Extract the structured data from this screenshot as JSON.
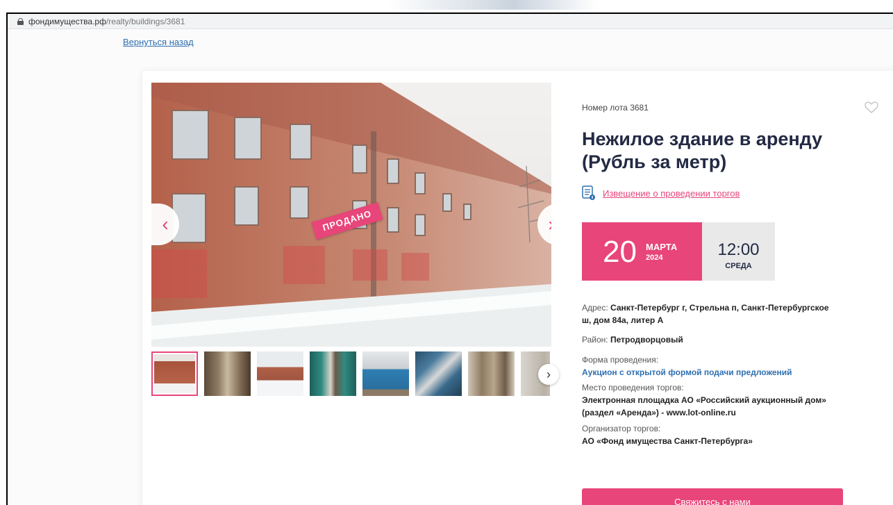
{
  "browser": {
    "url_domain": "фондимущества.рф",
    "url_path": "/realty/buildings/3681"
  },
  "page": {
    "back_link": "Вернуться назад"
  },
  "lot": {
    "number_label": "Номер лота 3681",
    "title": "Нежилое здание в аренду (Рубль за метр)",
    "notice_link": "Извещение о проведении торгов",
    "sold_stamp": "ПРОДАНО",
    "photo_count": 8,
    "active_photo": 1
  },
  "auction_date": {
    "day": "20",
    "month": "МАРТА",
    "year": "2024",
    "time": "12:00",
    "weekday": "СРЕДА"
  },
  "details": {
    "address_label": "Адрес:",
    "address_value": "Санкт-Петербург г, Стрельна п, Санкт-Петербургское ш, дом 84а, литер А",
    "district_label": "Район:",
    "district_value": "Петродворцовый",
    "form_label": "Форма проведения:",
    "form_value": "Аукцион с открытой формой подачи предложений",
    "place_label": "Место проведения торгов:",
    "place_value": "Электронная площадка АО «Российский аукционный дом» (раздел «Аренда») - www.lot-online.ru",
    "organizer_label": "Организатор торгов:",
    "organizer_value": "АО «Фонд имущества Санкт-Петербурга»"
  },
  "actions": {
    "contact_button": "Свяжитесь с нами"
  },
  "colors": {
    "accent": "#e8457a",
    "title": "#232a44",
    "link": "#2f6fb0",
    "date_grey": "#e9e9e9"
  },
  "icons": [
    "lock-icon",
    "heart-icon",
    "document-icon",
    "chevron-left-icon",
    "chevron-right-icon"
  ]
}
